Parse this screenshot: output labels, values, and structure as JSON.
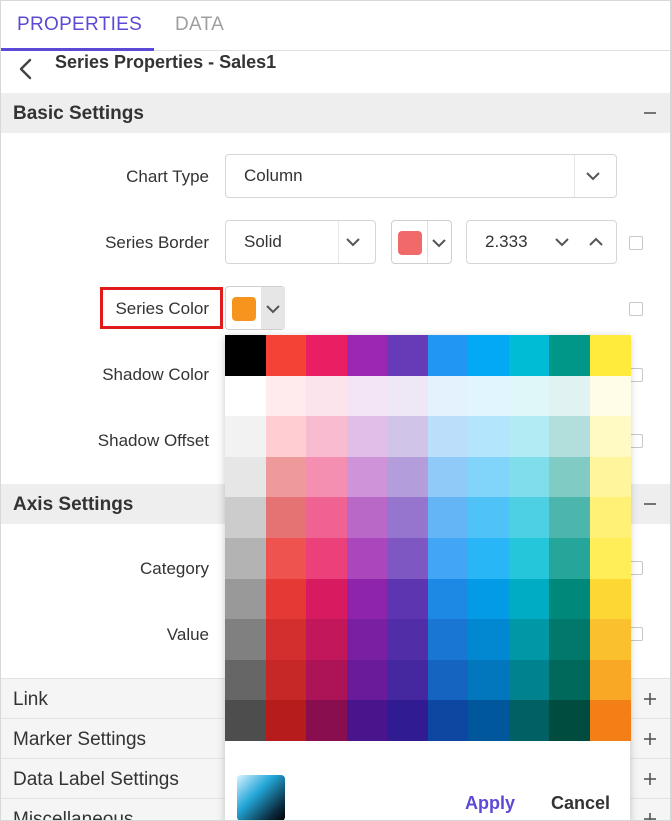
{
  "tabs": [
    {
      "label": "PROPERTIES",
      "active": true
    },
    {
      "label": "DATA",
      "active": false
    }
  ],
  "header": {
    "title": "Series Properties - Sales1"
  },
  "basic_settings": {
    "title": "Basic Settings",
    "toggle_icon": "minus-icon",
    "chart_type": {
      "label": "Chart Type",
      "value": "Column"
    },
    "series_border": {
      "label": "Series Border",
      "style": "Solid",
      "color": "#f06a6a",
      "width": "2.333"
    },
    "series_color": {
      "label": "Series Color",
      "color": "#f7941d"
    },
    "shadow_color": {
      "label": "Shadow Color"
    },
    "shadow_offset": {
      "label": "Shadow Offset"
    }
  },
  "axis_settings": {
    "title": "Axis Settings",
    "toggle_icon": "minus-icon",
    "category": {
      "label": "Category"
    },
    "value": {
      "label": "Value"
    }
  },
  "collapsed_sections": [
    {
      "label": "Link",
      "icon": "plus-icon"
    },
    {
      "label": "Marker Settings",
      "icon": "plus-icon"
    },
    {
      "label": "Data Label Settings",
      "icon": "plus-icon"
    },
    {
      "label": "Miscellaneous",
      "icon": "plus-icon"
    }
  ],
  "palette": {
    "columns": [
      [
        "#000000",
        "#ffffff",
        "#f2f2f2",
        "#e6e6e6",
        "#cccccc",
        "#b3b3b3",
        "#999999",
        "#808080",
        "#666666",
        "#4d4d4d"
      ],
      [
        "#f44336",
        "#ffebee",
        "#ffcdd2",
        "#ef9a9a",
        "#e57373",
        "#ef5350",
        "#e53935",
        "#d32f2f",
        "#c62828",
        "#b71c1c"
      ],
      [
        "#e91e63",
        "#fce4ec",
        "#f8bbd0",
        "#f48fb1",
        "#f06292",
        "#ec407a",
        "#d81b60",
        "#c2185b",
        "#ad1457",
        "#880e4f"
      ],
      [
        "#9c27b0",
        "#f3e5f5",
        "#e1bee7",
        "#ce93d8",
        "#ba68c8",
        "#ab47bc",
        "#8e24aa",
        "#7b1fa2",
        "#6a1b9a",
        "#4a148c"
      ],
      [
        "#673ab7",
        "#ede7f6",
        "#d1c4e9",
        "#b39ddb",
        "#9575cd",
        "#7e57c2",
        "#5e35b1",
        "#512da8",
        "#4527a0",
        "#311b92"
      ],
      [
        "#2196f3",
        "#e3f2fd",
        "#bbdefb",
        "#90caf9",
        "#64b5f6",
        "#42a5f5",
        "#1e88e5",
        "#1976d2",
        "#1565c0",
        "#0d47a1"
      ],
      [
        "#03a9f4",
        "#e1f5fe",
        "#b3e5fc",
        "#81d4fa",
        "#4fc3f7",
        "#29b6f6",
        "#039be5",
        "#0288d1",
        "#0277bd",
        "#01579b"
      ],
      [
        "#00bcd4",
        "#e0f7fa",
        "#b2ebf2",
        "#80deea",
        "#4dd0e1",
        "#26c6da",
        "#00acc1",
        "#0097a7",
        "#00838f",
        "#006064"
      ],
      [
        "#009688",
        "#e0f2f1",
        "#b2dfdb",
        "#80cbc4",
        "#4db6ac",
        "#26a69a",
        "#00897b",
        "#00796b",
        "#00695c",
        "#004d40"
      ],
      [
        "#ffeb3b",
        "#fffde7",
        "#fff9c4",
        "#fff59d",
        "#fff176",
        "#ffee58",
        "#fdd835",
        "#fbc02d",
        "#f9a825",
        "#f57f17"
      ]
    ],
    "apply_label": "Apply",
    "cancel_label": "Cancel"
  },
  "colors": {
    "accent": "#5b4ad6",
    "highlight": "#e01b1b"
  }
}
